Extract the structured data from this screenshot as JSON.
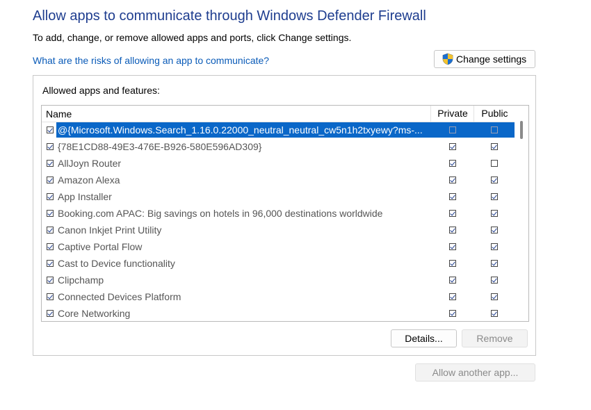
{
  "header": {
    "title": "Allow apps to communicate through Windows Defender Firewall",
    "subtitle": "To add, change, or remove allowed apps and ports, click Change settings.",
    "risk_link": "What are the risks of allowing an app to communicate?",
    "change_settings_label": "Change settings"
  },
  "panel": {
    "label": "Allowed apps and features:",
    "columns": {
      "name": "Name",
      "private": "Private",
      "public": "Public"
    },
    "rows": [
      {
        "name": "@{Microsoft.Windows.Search_1.16.0.22000_neutral_neutral_cw5n1h2txyewy?ms-...",
        "enabled": true,
        "private": false,
        "public": false,
        "selected": true
      },
      {
        "name": "{78E1CD88-49E3-476E-B926-580E596AD309}",
        "enabled": true,
        "private": true,
        "public": true
      },
      {
        "name": "AllJoyn Router",
        "enabled": true,
        "private": true,
        "public": false
      },
      {
        "name": "Amazon Alexa",
        "enabled": true,
        "private": true,
        "public": true
      },
      {
        "name": "App Installer",
        "enabled": true,
        "private": true,
        "public": true
      },
      {
        "name": "Booking.com APAC: Big savings on hotels in 96,000 destinations worldwide",
        "enabled": true,
        "private": true,
        "public": true
      },
      {
        "name": "Canon Inkjet Print Utility",
        "enabled": true,
        "private": true,
        "public": true
      },
      {
        "name": "Captive Portal Flow",
        "enabled": true,
        "private": true,
        "public": true
      },
      {
        "name": "Cast to Device functionality",
        "enabled": true,
        "private": true,
        "public": true
      },
      {
        "name": "Clipchamp",
        "enabled": true,
        "private": true,
        "public": true
      },
      {
        "name": "Connected Devices Platform",
        "enabled": true,
        "private": true,
        "public": true
      },
      {
        "name": "Core Networking",
        "enabled": true,
        "private": true,
        "public": true
      }
    ],
    "details_label": "Details...",
    "remove_label": "Remove"
  },
  "allow_another_label": "Allow another app...",
  "colors": {
    "title": "#1e3d8f",
    "link": "#0a5bb8",
    "selection": "#0a67c8"
  }
}
